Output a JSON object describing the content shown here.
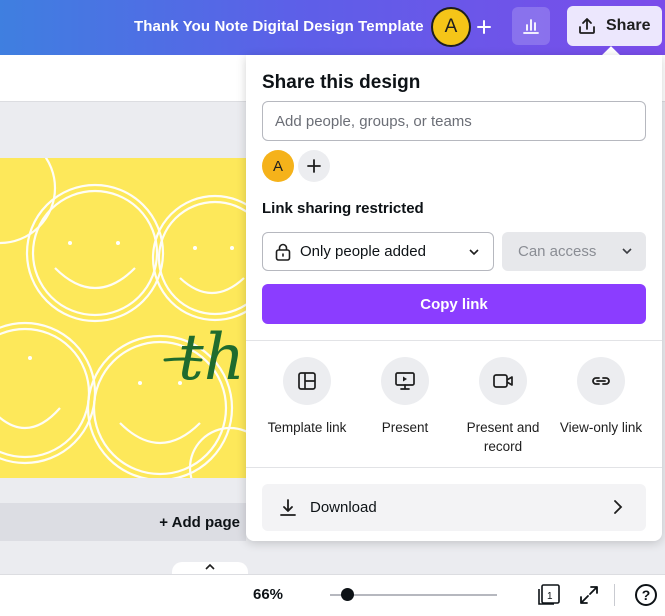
{
  "header": {
    "doc_title": "Thank You Note Digital Design Template",
    "avatar_initial": "A",
    "share_label": "Share"
  },
  "canvas": {
    "script_text": "th",
    "add_page_label": "+ Add page"
  },
  "footer": {
    "zoom": "66%",
    "zoom_level_percent": 66,
    "page_count": "1"
  },
  "share_panel": {
    "title": "Share this design",
    "people_placeholder": "Add people, groups, or teams",
    "avatar_initial": "A",
    "link_section_label": "Link sharing restricted",
    "access_value": "Only people added",
    "permission_value": "Can access",
    "copy_link_label": "Copy link",
    "options": [
      {
        "label": "Template link",
        "icon": "template-icon"
      },
      {
        "label": "Present",
        "icon": "present-icon"
      },
      {
        "label": "Present and record",
        "icon": "record-icon"
      },
      {
        "label": "View-only link",
        "icon": "link-icon"
      }
    ],
    "download_label": "Download"
  },
  "colors": {
    "accent": "#8b3dff",
    "canvas_bg": "#fde85a",
    "avatar": "#f5c518"
  }
}
